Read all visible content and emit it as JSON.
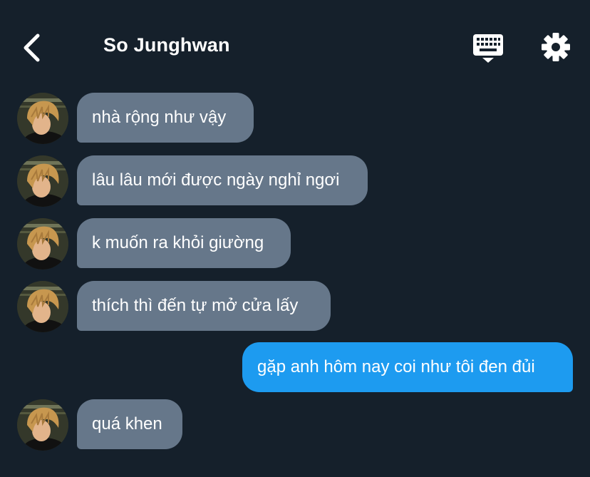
{
  "header": {
    "title": "So Junghwan",
    "back_icon": "chevron-left-icon",
    "keyboard_icon": "keyboard-icon",
    "settings_icon": "gear-icon"
  },
  "colors": {
    "background": "#15202b",
    "incoming_bubble": "#66778a",
    "outgoing_bubble": "#1d9bf0",
    "text": "#ffffff"
  },
  "messages": [
    {
      "direction": "in",
      "text": "nhà rộng như vậy"
    },
    {
      "direction": "in",
      "text": "lâu lâu mới được ngày nghỉ ngơi"
    },
    {
      "direction": "in",
      "text": "k muốn ra khỏi giường"
    },
    {
      "direction": "in",
      "text": "thích thì đến tự mở cửa lấy"
    },
    {
      "direction": "out",
      "text": "gặp anh hôm nay coi như tôi đen đủi"
    },
    {
      "direction": "in",
      "text": "quá khen"
    }
  ]
}
